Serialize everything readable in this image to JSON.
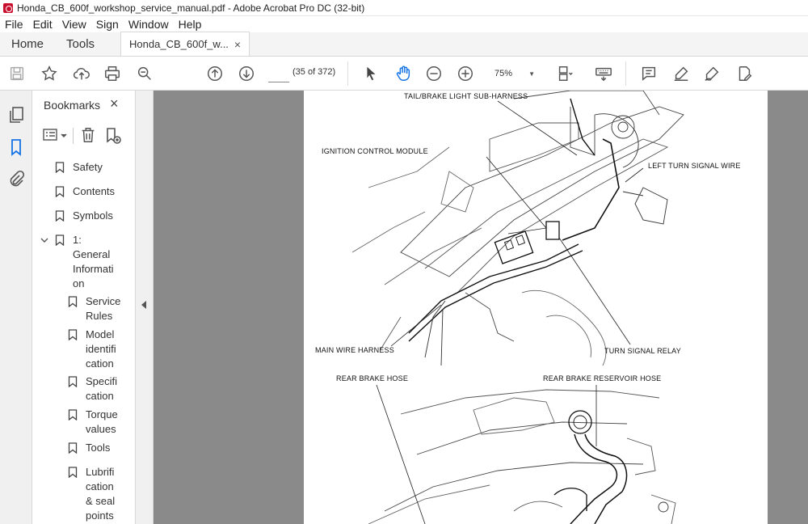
{
  "window": {
    "title": "Honda_CB_600f_workshop_service_manual.pdf - Adobe Acrobat Pro DC (32-bit)"
  },
  "menu": [
    "File",
    "Edit",
    "View",
    "Sign",
    "Window",
    "Help"
  ],
  "tabs": {
    "home": "Home",
    "tools": "Tools",
    "document": "Honda_CB_600f_w...",
    "close": "×"
  },
  "toolbar": {
    "page_current": "",
    "page_count": "(35 of 372)",
    "zoom": "75%"
  },
  "bookmarks": {
    "title": "Bookmarks",
    "close": "×",
    "items": [
      {
        "label": "Safety"
      },
      {
        "label": "Contents"
      },
      {
        "label": "Symbols"
      },
      {
        "label": "1:\nGeneral\nInformati\non"
      },
      {
        "label": "Service\nRules"
      },
      {
        "label": "Model\nidentifi\ncation"
      },
      {
        "label": "Specifi\ncation"
      },
      {
        "label": "Torque\nvalues"
      },
      {
        "label": "Tools"
      },
      {
        "label": "Lubrifi\ncation\n& seal\npoints"
      }
    ]
  },
  "diagram": {
    "labels": {
      "tail_brake": "TAIL/BRAKE LIGHT SUB-HARNESS",
      "ignition": "IGNITION CONTROL MODULE",
      "left_turn": "LEFT TURN SIGNAL WIRE",
      "main_wire": "MAIN WIRE HARNESS",
      "turn_relay": "TURN SIGNAL RELAY",
      "rear_brake_hose": "REAR BRAKE HOSE",
      "rear_reservoir": "REAR BRAKE RESERVOIR HOSE"
    }
  }
}
